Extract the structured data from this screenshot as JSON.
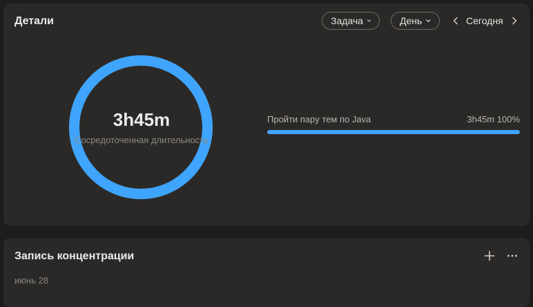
{
  "details": {
    "title": "Детали",
    "filter_task_label": "Задача",
    "filter_period_label": "День",
    "date_nav_label": "Сегодня",
    "accent_color": "#3fa4fb",
    "ring": {
      "value": "3h45m",
      "caption": "Сосредоточенная длительность",
      "progress_fraction": 1.0
    },
    "tasks": [
      {
        "name": "Пройти пару тем по Java",
        "duration": "3h45m",
        "percent": "100%",
        "fraction": 1.0
      }
    ]
  },
  "focus_log": {
    "title": "Запись концентрации",
    "date": "июнь 28"
  }
}
